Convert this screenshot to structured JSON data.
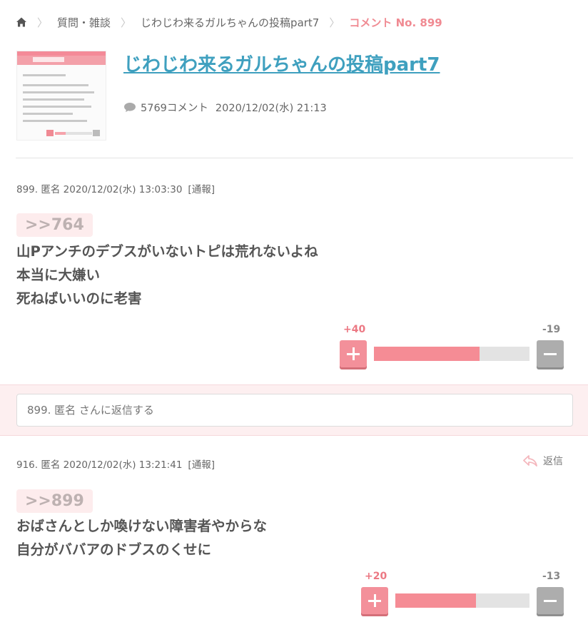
{
  "breadcrumb": {
    "category": "質問・雑談",
    "topic": "じわじわ来るガルちゃんの投稿part7",
    "current": "コメント No. 899"
  },
  "topic": {
    "title": "じわじわ来るガルちゃんの投稿part7",
    "comment_count": "5769コメント",
    "date": "2020/12/02(水) 21:13"
  },
  "comments": [
    {
      "meta": "899. 匿名 2020/12/02(水) 13:03:30",
      "report": "[通報]",
      "anchor": ">>764",
      "lines": [
        "山Pアンチのデブスがいないトピは荒れないよね",
        "本当に大嫌い",
        "死ねばいいのに老害"
      ],
      "plus": "+40",
      "minus": "-19",
      "plus_ratio": 0.68
    },
    {
      "meta": "916. 匿名 2020/12/02(水) 13:21:41",
      "report": "[通報]",
      "reply_label": "返信",
      "anchor": ">>899",
      "lines": [
        "おばさんとしか喚けない障害者やからな",
        "自分がババアのドブスのくせに"
      ],
      "plus": "+20",
      "minus": "-13",
      "plus_ratio": 0.6
    }
  ],
  "reply_box": {
    "placeholder": "899. 匿名 さんに返信する"
  },
  "colors": {
    "accent_pink": "#f08a92",
    "title_blue": "#3fa0bf",
    "vote_minus": "#adadad"
  }
}
